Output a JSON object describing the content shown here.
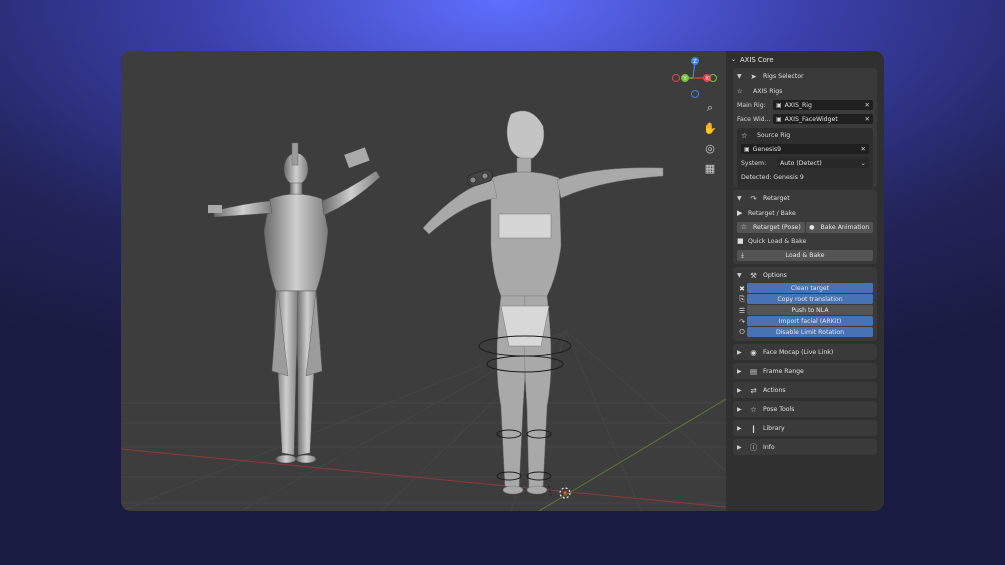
{
  "panel": {
    "title": "AXIS Core",
    "rigs_selector": {
      "header": "Rigs Selector",
      "axis_rigs_label": "AXIS Rigs",
      "main_rig_label": "Main Rig:",
      "main_rig_value": "AXIS_Rig",
      "face_widget_label": "Face Wid...",
      "face_widget_value": "AXIS_FaceWidget",
      "source_rig_header": "Source Rig",
      "source_rig_value": "Genesis9",
      "system_label": "System:",
      "system_value": "Auto (Detect)",
      "detected_text": "Detected: Genesis 9"
    },
    "retarget": {
      "header": "Retarget",
      "retarget_bake_label": "Retarget / Bake",
      "retarget_pose_button": "Retarget (Pose)",
      "bake_animation_button": "Bake Animation",
      "quick_load_label": "Quick Load & Bake",
      "load_bake_button": "Load & Bake"
    },
    "options": {
      "header": "Options",
      "items": [
        {
          "label": "Clean target",
          "active": true
        },
        {
          "label": "Copy root translation",
          "active": true
        },
        {
          "label": "Push to NLA",
          "active": false
        },
        {
          "label": "Import facial (ARKit)",
          "active": true
        },
        {
          "label": "Disable Limit Rotation",
          "active": true
        }
      ]
    },
    "collapsed_sections": [
      "Face Mocap (Live Link)",
      "Frame Range",
      "Actions",
      "Pose Tools",
      "Library",
      "Info"
    ]
  },
  "viewport": {
    "gizmo_axes": [
      "Z",
      "Y",
      "X"
    ]
  },
  "colors": {
    "accent_blue": "#4772b3",
    "panel_bg": "#303030",
    "section_bg": "#3a3a3a",
    "viewport_bg": "#3d3d3d",
    "axis_x": "#e0444f",
    "axis_y": "#7ac142",
    "axis_z": "#3f82e8"
  }
}
